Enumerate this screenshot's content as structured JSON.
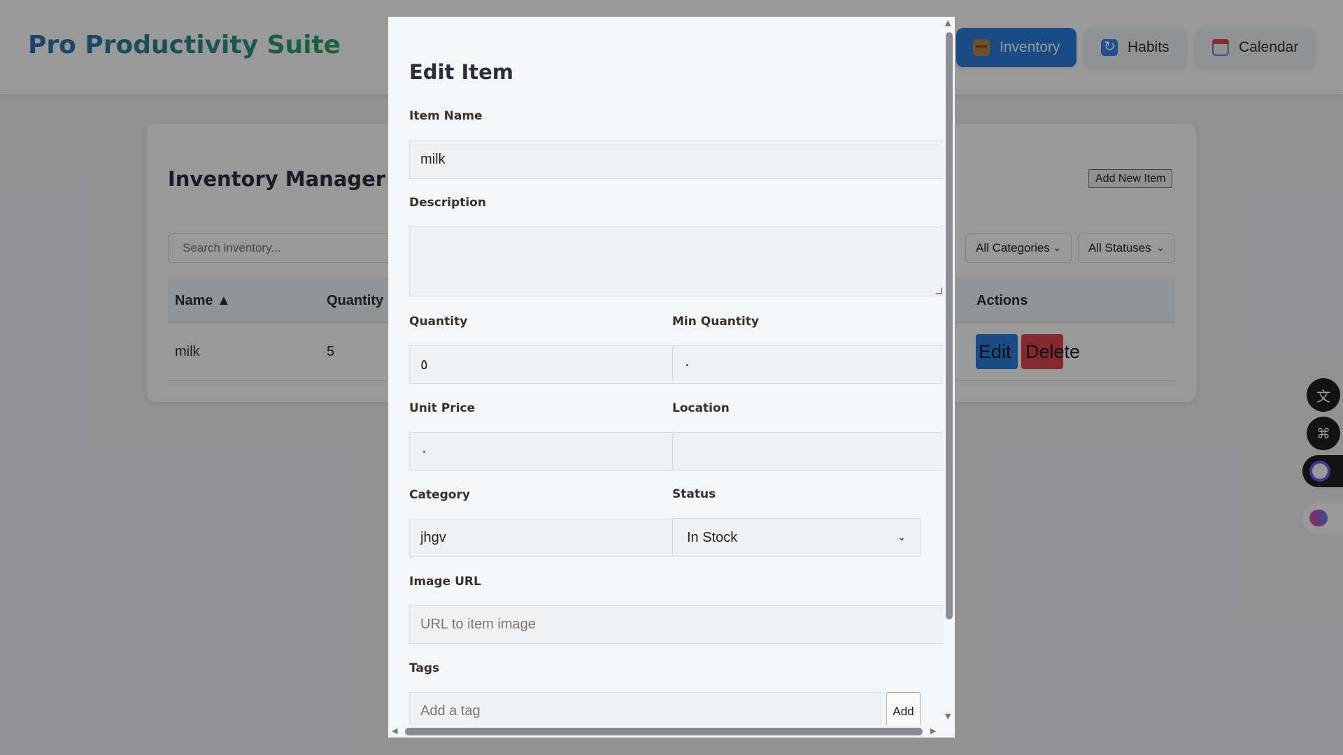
{
  "app": {
    "title": "Pro Productivity Suite"
  },
  "nav": {
    "items": [
      {
        "label": "Inventory",
        "icon": "box-icon",
        "active": true
      },
      {
        "label": "Habits",
        "icon": "refresh-icon",
        "active": false
      },
      {
        "label": "Calendar",
        "icon": "calendar-icon",
        "active": false
      }
    ]
  },
  "inventory": {
    "title": "Inventory Manager",
    "add_button": "Add New Item",
    "search_placeholder": "Search inventory...",
    "category_filter": "All Categories",
    "status_filter": "All Statuses",
    "columns": [
      "Name ▲",
      "Quantity",
      "Actions"
    ],
    "rows": [
      {
        "name": "milk",
        "quantity": "5",
        "edit": "Edit",
        "delete": "Delete"
      }
    ]
  },
  "modal": {
    "title": "Edit Item",
    "fields": {
      "item_name": {
        "label": "Item Name",
        "value": "milk"
      },
      "description": {
        "label": "Description",
        "value": ""
      },
      "quantity": {
        "label": "Quantity",
        "value": "٥"
      },
      "min_quantity": {
        "label": "Min Quantity",
        "value": "٠"
      },
      "unit_price": {
        "label": "Unit Price",
        "value": "٠"
      },
      "location": {
        "label": "Location",
        "value": ""
      },
      "category": {
        "label": "Category",
        "value": "jhgv"
      },
      "status": {
        "label": "Status",
        "value": "In Stock"
      },
      "image_url": {
        "label": "Image URL",
        "placeholder": "URL to item image"
      },
      "tags": {
        "label": "Tags",
        "placeholder": "Add a tag",
        "add_button": "Add"
      }
    }
  },
  "floating_tools": [
    "translate-icon",
    "apps-grid-icon",
    "assistant-face-icon",
    "brain-icon"
  ],
  "colors": {
    "primary": "#2a7de1",
    "danger": "#e0454d",
    "title_start": "#2f6fb3",
    "title_end": "#2ea36a"
  }
}
